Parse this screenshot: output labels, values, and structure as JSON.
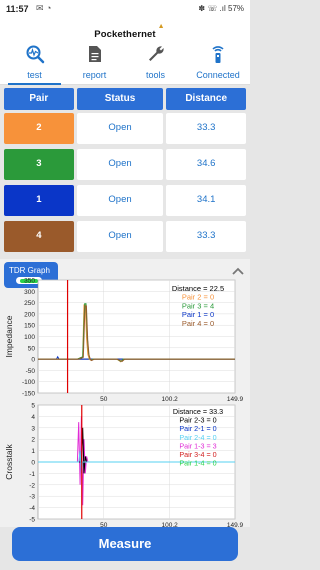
{
  "status_bar": {
    "time": "11:57",
    "left_icons": "✉ ◔",
    "right_text": "✽ ☏ .ıl 57%"
  },
  "app": {
    "logo": "Pockethernet"
  },
  "tabs": [
    {
      "label": "test",
      "icon": "search-waveform-icon",
      "active": true
    },
    {
      "label": "report",
      "icon": "document-icon",
      "active": false
    },
    {
      "label": "tools",
      "icon": "wrench-icon",
      "active": false
    },
    {
      "label": "Connected",
      "icon": "remote-connected-icon",
      "active": false
    }
  ],
  "table": {
    "headers": [
      "Pair",
      "Status",
      "Distance"
    ],
    "rows": [
      {
        "pair": "2",
        "color": "#f7923a",
        "status": "Open",
        "distance": "33.3"
      },
      {
        "pair": "3",
        "color": "#2b9a3a",
        "status": "Open",
        "distance": "34.6"
      },
      {
        "pair": "1",
        "color": "#0a36c8",
        "status": "Open",
        "distance": "34.1"
      },
      {
        "pair": "4",
        "color": "#9a5a2b",
        "status": "Open",
        "distance": "33.3"
      }
    ]
  },
  "tdr": {
    "label": "TDR Graph"
  },
  "chart_data": [
    {
      "type": "line",
      "ylabel": "Impedance",
      "xlabel": "Distance",
      "xlim": [
        0,
        149.9
      ],
      "ylim": [
        -150,
        350
      ],
      "x_ticks": [
        "50",
        "100.2",
        "149.9"
      ],
      "y_ticks": [
        "350",
        "300",
        "250",
        "200",
        "150",
        "100",
        "50",
        "0",
        "-50",
        "-100",
        "-150"
      ],
      "marker_x": 22.5,
      "legend": [
        {
          "text": "Distance = 22.5",
          "color": "#000000"
        },
        {
          "text": "Pair 2 = 0",
          "color": "#f7923a"
        },
        {
          "text": "Pair 3 = 4",
          "color": "#2b9a3a"
        },
        {
          "text": "Pair 1 = 0",
          "color": "#0a36c8"
        },
        {
          "text": "Pair 4 = 0",
          "color": "#9a5a2b"
        }
      ],
      "series": [
        {
          "color": "#0a36c8",
          "x": [
            0,
            5,
            10,
            14,
            15,
            16,
            17,
            18,
            19,
            20,
            25,
            30,
            40,
            50,
            60,
            149.9
          ],
          "y": [
            0,
            0,
            0,
            0,
            10,
            0,
            0,
            0,
            0,
            0,
            0,
            0,
            0,
            0,
            0,
            0
          ]
        },
        {
          "color": "#f7923a",
          "x": [
            0,
            30,
            34,
            35,
            36,
            37,
            38,
            39,
            40,
            42,
            60,
            63,
            65,
            149.9
          ],
          "y": [
            0,
            0,
            10,
            240,
            240,
            90,
            20,
            0,
            -5,
            0,
            0,
            -12,
            0,
            0
          ]
        },
        {
          "color": "#2b9a3a",
          "x": [
            0,
            30,
            34,
            35.5,
            36.5,
            37.5,
            38.5,
            39.5,
            40.5,
            42,
            60,
            63,
            65,
            149.9
          ],
          "y": [
            0,
            0,
            10,
            245,
            245,
            95,
            25,
            0,
            -5,
            0,
            0,
            -10,
            0,
            0
          ]
        },
        {
          "color": "#9a5a2b",
          "x": [
            0,
            31,
            34.5,
            35.8,
            36.8,
            37.8,
            38.8,
            39.8,
            40.8,
            43,
            60,
            64,
            66,
            149.9
          ],
          "y": [
            0,
            0,
            8,
            235,
            235,
            85,
            18,
            0,
            -6,
            0,
            0,
            -10,
            0,
            0
          ]
        }
      ]
    },
    {
      "type": "line",
      "ylabel": "Crosstalk",
      "xlabel": "",
      "xlim": [
        0,
        149.9
      ],
      "ylim": [
        -5,
        5
      ],
      "x_ticks": [
        "50",
        "100.2",
        "149.9"
      ],
      "y_ticks": [
        "5",
        "4",
        "3",
        "2",
        "1",
        "0",
        "-1",
        "-2",
        "-3",
        "-4",
        "-5"
      ],
      "marker_x": 33.3,
      "legend": [
        {
          "text": "Distance = 33.3",
          "color": "#000000"
        },
        {
          "text": "Pair 2-3 = 0",
          "color": "#000000"
        },
        {
          "text": "Pair 2-1 = 0",
          "color": "#0a36c8"
        },
        {
          "text": "Pair 2-4 = 0",
          "color": "#56d0f2"
        },
        {
          "text": "Pair 1-3 = 3",
          "color": "#e02bd6"
        },
        {
          "text": "Pair 3-4 = 0",
          "color": "#d22020"
        },
        {
          "text": "Pair 1-4 = 0",
          "color": "#2bd24a"
        }
      ],
      "series": [
        {
          "color": "#e02bd6",
          "x": [
            0,
            30,
            31,
            32,
            33,
            34,
            35,
            36,
            37,
            38,
            40,
            149.9
          ],
          "y": [
            0,
            0,
            3.5,
            -2,
            4,
            -3.8,
            2,
            -1,
            0.5,
            0,
            0,
            0
          ]
        },
        {
          "color": "#000000",
          "x": [
            0,
            33,
            34,
            35,
            36,
            37,
            149.9
          ],
          "y": [
            0,
            0,
            3,
            -1,
            0.5,
            0,
            0
          ]
        },
        {
          "color": "#56d0f2",
          "x": [
            0,
            31,
            32,
            33,
            34,
            149.9
          ],
          "y": [
            0,
            0,
            1,
            -1,
            0,
            0
          ]
        }
      ]
    }
  ],
  "measure": {
    "label": "Measure"
  }
}
